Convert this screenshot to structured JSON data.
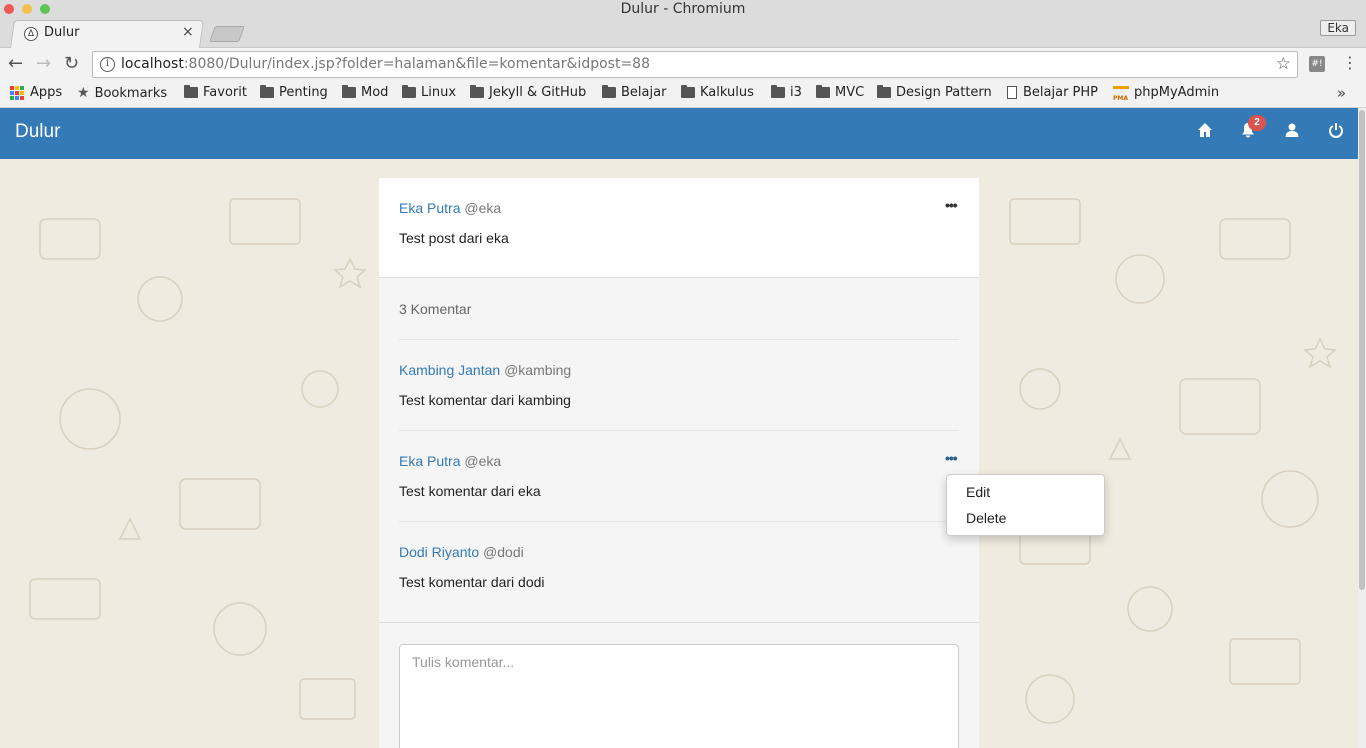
{
  "window": {
    "title": "Dulur - Chromium",
    "profile": "Eka"
  },
  "tab": {
    "title": "Dulur",
    "close": "×"
  },
  "address": {
    "host": "localhost",
    "rest": ":8080/Dulur/index.jsp?folder=halaman&file=komentar&idpost=88"
  },
  "bookmarks": [
    {
      "label": "Apps",
      "icon": "apps-icon"
    },
    {
      "label": "Bookmarks",
      "icon": "star-icon"
    },
    {
      "label": "Favorit",
      "icon": "folder-icon"
    },
    {
      "label": "Penting",
      "icon": "folder-icon"
    },
    {
      "label": "Mod",
      "icon": "folder-icon"
    },
    {
      "label": "Linux",
      "icon": "folder-icon"
    },
    {
      "label": "Jekyll & GitHub",
      "icon": "folder-icon"
    },
    {
      "label": "Belajar",
      "icon": "folder-icon"
    },
    {
      "label": "Kalkulus",
      "icon": "folder-icon"
    },
    {
      "label": "i3",
      "icon": "folder-icon"
    },
    {
      "label": "MVC",
      "icon": "folder-icon"
    },
    {
      "label": "Design Pattern",
      "icon": "folder-icon"
    },
    {
      "label": "Belajar PHP",
      "icon": "document-icon"
    },
    {
      "label": "phpMyAdmin",
      "icon": "phpmyadmin-icon"
    }
  ],
  "app": {
    "brand": "Dulur",
    "notification_count": "2",
    "header_color": "#337ab7"
  },
  "post": {
    "author": "Eka Putra",
    "handle": "@eka",
    "text": "Test post dari eka",
    "menu": "•••"
  },
  "comments_count": "3 Komentar",
  "comments": [
    {
      "author": "Kambing Jantan",
      "handle": "@kambing",
      "text": "Test komentar dari kambing"
    },
    {
      "author": "Eka Putra",
      "handle": "@eka",
      "text": "Test komentar dari eka",
      "menu": "•••"
    },
    {
      "author": "Dodi Riyanto",
      "handle": "@dodi",
      "text": "Test komentar dari dodi"
    }
  ],
  "dropdown": {
    "edit": "Edit",
    "delete": "Delete"
  },
  "comment_input": {
    "placeholder": "Tulis komentar..."
  }
}
